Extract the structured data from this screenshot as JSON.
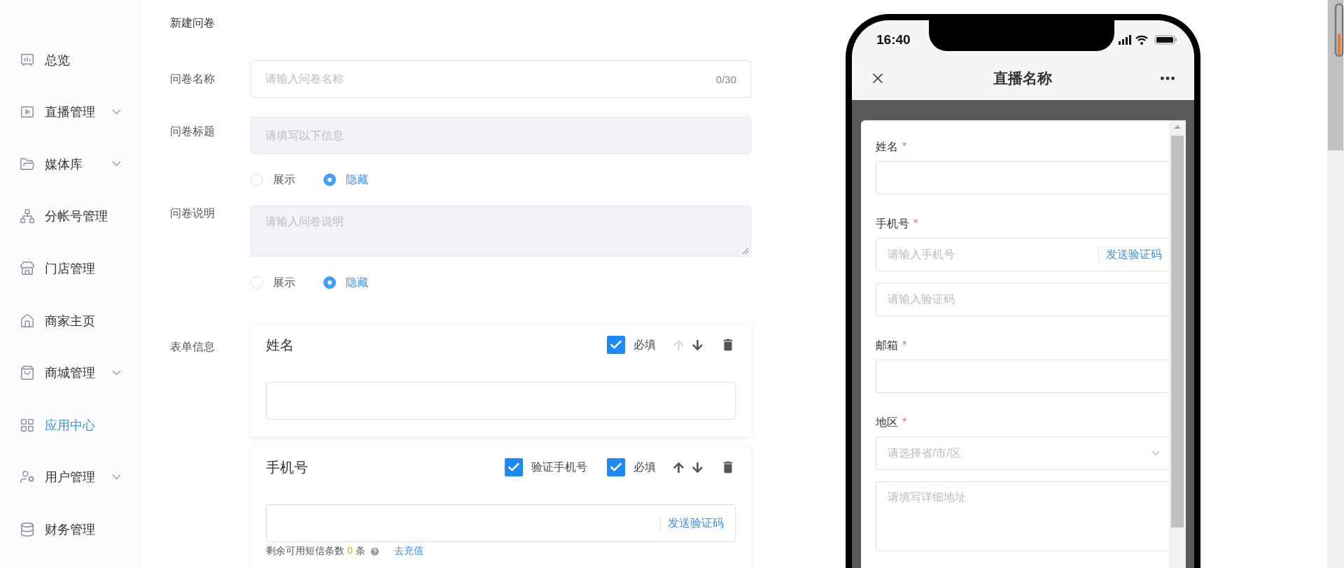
{
  "sidebar": {
    "items": [
      {
        "label": "总览",
        "expandable": false,
        "selected": false
      },
      {
        "label": "直播管理",
        "expandable": true,
        "selected": false
      },
      {
        "label": "媒体库",
        "expandable": true,
        "selected": false
      },
      {
        "label": "分帐号管理",
        "expandable": false,
        "selected": false
      },
      {
        "label": "门店管理",
        "expandable": false,
        "selected": false
      },
      {
        "label": "商家主页",
        "expandable": false,
        "selected": false
      },
      {
        "label": "商城管理",
        "expandable": true,
        "selected": false
      },
      {
        "label": "应用中心",
        "expandable": false,
        "selected": true
      },
      {
        "label": "用户管理",
        "expandable": true,
        "selected": false
      },
      {
        "label": "财务管理",
        "expandable": false,
        "selected": false
      }
    ]
  },
  "page_title": "新建问卷",
  "form": {
    "name": {
      "label": "问卷名称",
      "placeholder": "请输入问卷名称",
      "counter": "0/30"
    },
    "title": {
      "label": "问卷标题",
      "placeholder": "请填写以下信息",
      "disabled": true,
      "visibility": [
        {
          "label": "展示",
          "selected": false
        },
        {
          "label": "隐藏",
          "selected": true
        }
      ]
    },
    "description": {
      "label": "问卷说明",
      "placeholder": "请输入问卷说明",
      "disabled": true,
      "visibility": [
        {
          "label": "展示",
          "selected": false
        },
        {
          "label": "隐藏",
          "selected": true
        }
      ]
    },
    "fields_label": "表单信息",
    "fields": [
      {
        "kind": "text",
        "title": "姓名",
        "options": [
          {
            "label": "必填",
            "checked": true
          }
        ],
        "up_disabled": true,
        "down_disabled": false
      },
      {
        "kind": "phone",
        "title": "手机号",
        "options": [
          {
            "label": "验证手机号",
            "checked": true
          },
          {
            "label": "必填",
            "checked": true
          }
        ],
        "up_disabled": false,
        "down_disabled": false,
        "send_code": "发送验证码",
        "sms_note": {
          "text": "剩余可用短信条数",
          "count": "0",
          "unit": "条",
          "link": "去充值"
        }
      }
    ]
  },
  "preview": {
    "time": "16:40",
    "title": "直播名称",
    "fields": [
      {
        "kind": "text",
        "label": "姓名",
        "required_mark": "*"
      },
      {
        "kind": "phone",
        "label": "手机号",
        "required_mark": "*",
        "placeholder": "请输入手机号",
        "send_code": "发送验证码",
        "code_placeholder": "请输入验证码"
      },
      {
        "kind": "text",
        "label": "邮箱",
        "required_mark": "*"
      },
      {
        "kind": "region",
        "label": "地区",
        "required_mark": "*",
        "placeholder": "请选择省/市/区",
        "address_placeholder": "请填写详细地址"
      }
    ]
  }
}
